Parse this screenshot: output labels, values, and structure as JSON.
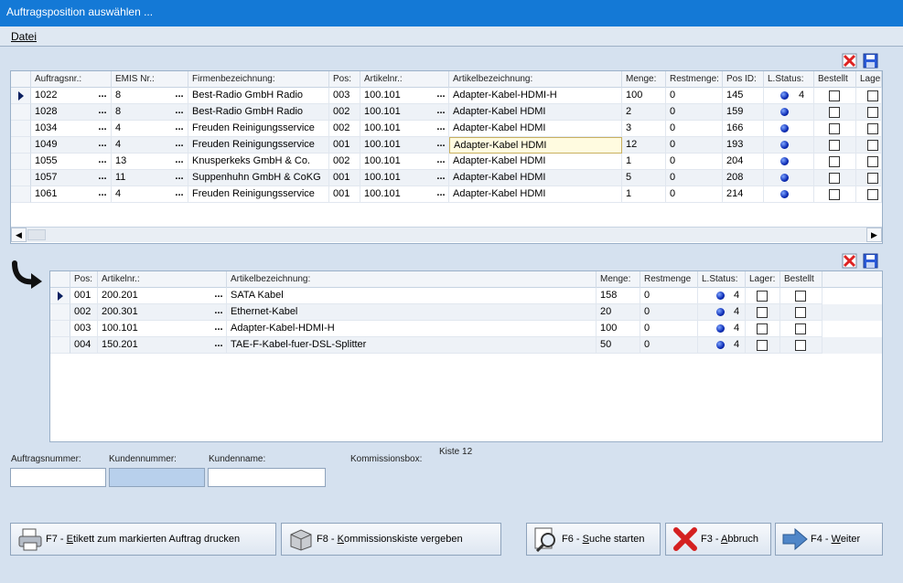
{
  "window": {
    "title": "Auftragsposition auswählen ..."
  },
  "menu": {
    "datei": "Datei"
  },
  "upper": {
    "headers": [
      "Auftragsnr.:",
      "EMIS Nr.:",
      "Firmenbezeichnung:",
      "Pos:",
      "Artikelnr.:",
      "Artikelbezeichnung:",
      "Menge:",
      "Restmenge:",
      "Pos ID:",
      "L.Status:",
      "Bestellt",
      "Lager"
    ],
    "rows": [
      {
        "auftragsnr": "1022",
        "emis": "8",
        "firma": "Best-Radio GmbH Radio",
        "pos": "003",
        "artikelnr": "100.101",
        "bezeichnung": "Adapter-Kabel-HDMI-H",
        "menge": "100",
        "rest": "0",
        "posid": "145",
        "lstatus": "4"
      },
      {
        "auftragsnr": "1028",
        "emis": "8",
        "firma": "Best-Radio GmbH Radio",
        "pos": "002",
        "artikelnr": "100.101",
        "bezeichnung": "Adapter-Kabel HDMI",
        "menge": "2",
        "rest": "0",
        "posid": "159",
        "lstatus": ""
      },
      {
        "auftragsnr": "1034",
        "emis": "4",
        "firma": "Freuden Reinigungsservice",
        "pos": "002",
        "artikelnr": "100.101",
        "bezeichnung": "Adapter-Kabel HDMI",
        "menge": "3",
        "rest": "0",
        "posid": "166",
        "lstatus": ""
      },
      {
        "auftragsnr": "1049",
        "emis": "4",
        "firma": "Freuden Reinigungsservice",
        "pos": "001",
        "artikelnr": "100.101",
        "bezeichnung": "Adapter-Kabel HDMI",
        "menge": "12",
        "rest": "0",
        "posid": "193",
        "lstatus": ""
      },
      {
        "auftragsnr": "1055",
        "emis": "13",
        "firma": "Knusperkeks GmbH & Co.",
        "pos": "002",
        "artikelnr": "100.101",
        "bezeichnung": "Adapter-Kabel HDMI",
        "menge": "1",
        "rest": "0",
        "posid": "204",
        "lstatus": ""
      },
      {
        "auftragsnr": "1057",
        "emis": "11",
        "firma": "Suppenhuhn GmbH & CoKG",
        "pos": "001",
        "artikelnr": "100.101",
        "bezeichnung": "Adapter-Kabel HDMI",
        "menge": "5",
        "rest": "0",
        "posid": "208",
        "lstatus": ""
      },
      {
        "auftragsnr": "1061",
        "emis": "4",
        "firma": "Freuden Reinigungsservice",
        "pos": "001",
        "artikelnr": "100.101",
        "bezeichnung": "Adapter-Kabel HDMI",
        "menge": "1",
        "rest": "0",
        "posid": "214",
        "lstatus": ""
      }
    ]
  },
  "lower": {
    "headers": [
      "Pos:",
      "Artikelnr.:",
      "Artikelbezeichnung:",
      "Menge:",
      "Restmenge",
      "L.Status:",
      "Lager:",
      "Bestellt"
    ],
    "rows": [
      {
        "pos": "001",
        "artikelnr": "200.201",
        "bezeichnung": "SATA Kabel",
        "menge": "158",
        "rest": "0",
        "lstatus": "4"
      },
      {
        "pos": "002",
        "artikelnr": "200.301",
        "bezeichnung": "Ethernet-Kabel",
        "menge": "20",
        "rest": "0",
        "lstatus": "4"
      },
      {
        "pos": "003",
        "artikelnr": "100.101",
        "bezeichnung": "Adapter-Kabel-HDMI-H",
        "menge": "100",
        "rest": "0",
        "lstatus": "4"
      },
      {
        "pos": "004",
        "artikelnr": "150.201",
        "bezeichnung": "TAE-F-Kabel-fuer-DSL-Splitter",
        "menge": "50",
        "rest": "0",
        "lstatus": "4"
      }
    ]
  },
  "dots": "...",
  "form": {
    "auftragsnummer_label": "Auftragsnummer:",
    "kundennummer_label": "Kundennummer:",
    "kundenname_label": "Kundenname:",
    "kommissionsbox_label": "Kommissionsbox:",
    "kommissionsbox_value": "Kiste 12",
    "auftragsnummer_value": "",
    "kundennummer_value": "",
    "kundenname_value": ""
  },
  "buttons": {
    "f7_prefix": "F7 - ",
    "f7_underlined": "E",
    "f7_rest": "tikett zum markierten Auftrag drucken",
    "f8_prefix": "F8 - ",
    "f8_underlined": "K",
    "f8_rest": "ommissionskiste vergeben",
    "f6_prefix": "F6 - ",
    "f6_underlined": "S",
    "f6_rest": "uche starten",
    "f3_prefix": "F3 - ",
    "f3_underlined": "A",
    "f3_rest": "bbruch",
    "f4_prefix": "F4 - ",
    "f4_underlined": "W",
    "f4_rest": "eiter"
  },
  "colors": {
    "titlebar": "#1479d6",
    "background": "#d5e1ef",
    "status_ball": "#0b2bb5"
  }
}
